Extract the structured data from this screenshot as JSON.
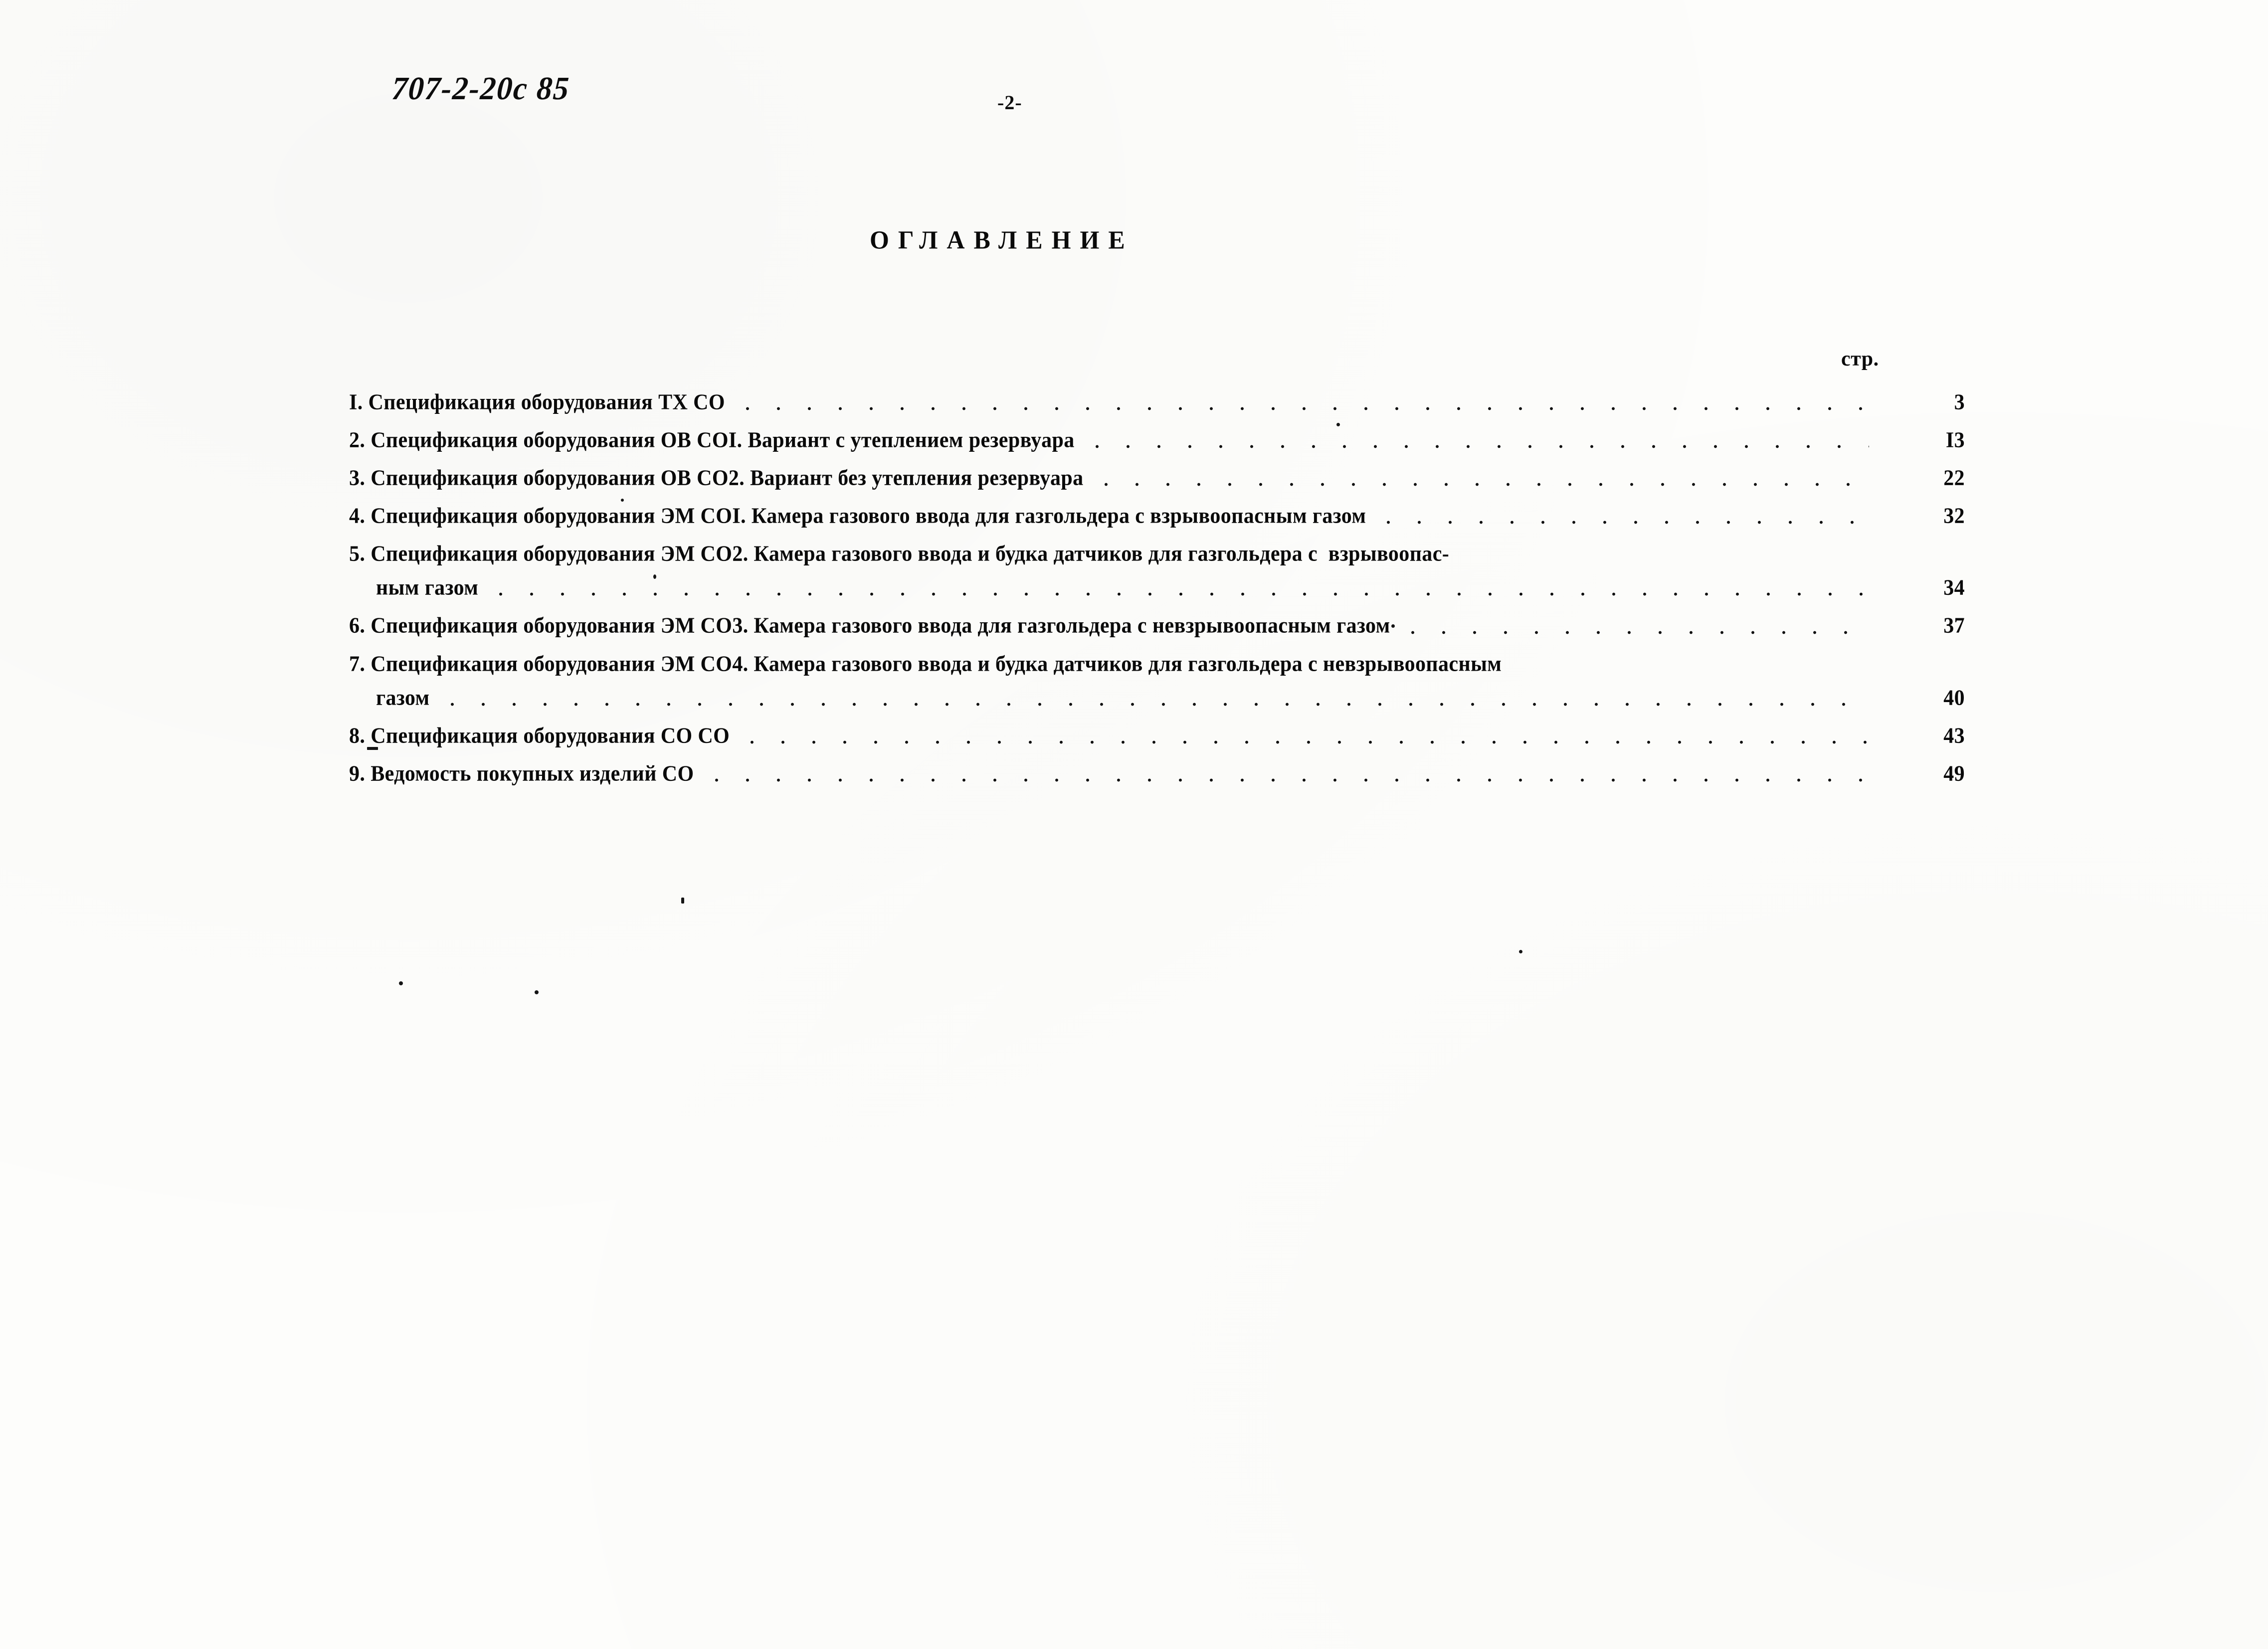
{
  "header": {
    "doc_code": "707-2-20с 85",
    "page_marker": "-2-"
  },
  "title": "ОГЛАВЛЕНИЕ",
  "pages_column_caption": "стр.",
  "entries": [
    {
      "number": "I.",
      "line1": "I. Спецификация оборудования ТХ СО",
      "line2": "",
      "page": "3"
    },
    {
      "number": "2.",
      "line1": "2. Спецификация оборудования ОВ СОI. Вариант с утеплением резервуара",
      "line2": "",
      "page": "I3"
    },
    {
      "number": "3.",
      "line1": "3. Спецификация оборудования ОВ СО2. Вариант без утепления резервуара",
      "line2": "",
      "page": "22"
    },
    {
      "number": "4.",
      "line1": "4. Спецификация оборудования ЭМ СОI. Камера газового ввода для газгольдера с взрывоопасным газом",
      "line2": "",
      "page": "32"
    },
    {
      "number": "5.",
      "line1": "5. Спецификация оборудования ЭМ СО2. Камера газового ввода и будка датчиков для газгольдера с  взрывоопас-",
      "line2": "ным газом",
      "page": "34"
    },
    {
      "number": "6.",
      "line1": "6. Спецификация оборудования ЭМ СО3. Камера газового ввода для газгольдера с невзрывоопасным газом",
      "line2": "",
      "page": "37"
    },
    {
      "number": "7.",
      "line1": "7. Спецификация оборудования ЭМ СО4. Камера газового ввода и будка датчиков для газгольдера с невзрывоопасным",
      "line2": "газом",
      "page": "40"
    },
    {
      "number": "8.",
      "line1": "8. Спецификация оборудования СО СО",
      "line2": "",
      "page": "43"
    },
    {
      "number": "9.",
      "line1": "9. Ведомость покупных изделий СО",
      "line2": "",
      "page": "49"
    }
  ]
}
